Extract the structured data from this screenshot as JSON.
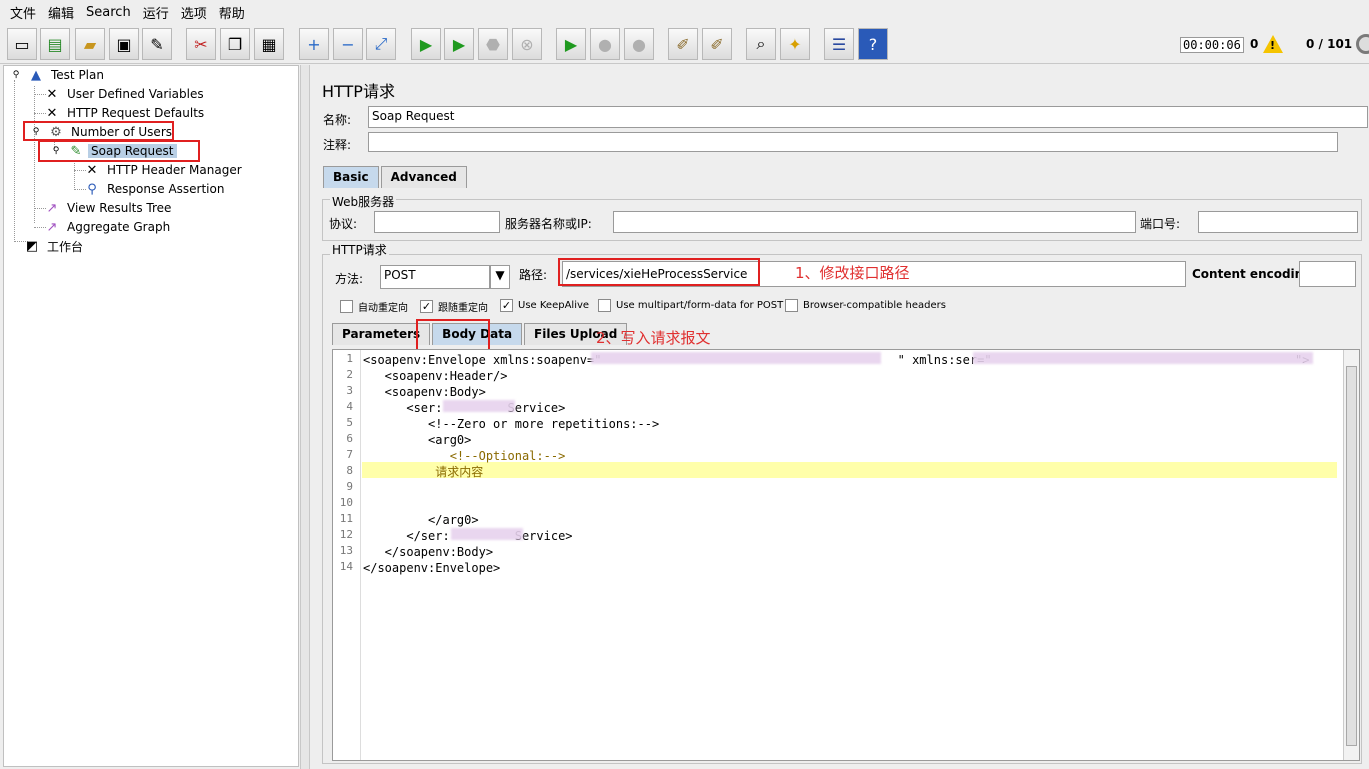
{
  "menu": [
    "文件",
    "编辑",
    "Search",
    "运行",
    "选项",
    "帮助"
  ],
  "status": {
    "timer": "00:00:06",
    "errors": "0",
    "threads": "0 / 101"
  },
  "tree": {
    "test_plan": "Test Plan",
    "user_defined_variables": "User Defined Variables",
    "http_request_defaults": "HTTP Request Defaults",
    "number_of_users": "Number of Users",
    "soap_request": "Soap Request",
    "http_header_manager": "HTTP Header Manager",
    "response_assertion": "Response Assertion",
    "view_results_tree": "View Results Tree",
    "aggregate_graph": "Aggregate Graph",
    "workbench": "工作台"
  },
  "panel": {
    "title": "HTTP请求",
    "name_label": "名称:",
    "name_value": "Soap Request",
    "comment_label": "注释:",
    "tabs": [
      "Basic",
      "Advanced"
    ],
    "web_server_title": "Web服务器",
    "protocol_label": "协议:",
    "server_label": "服务器名称或IP:",
    "port_label": "端口号:",
    "http_request_title": "HTTP请求",
    "method_label": "方法:",
    "method_value": "POST",
    "path_label": "路径:",
    "path_value": "/services/xieHeProcessService",
    "encoding_label": "Content encoding:",
    "checkboxes": [
      {
        "label": "自动重定向",
        "checked": false
      },
      {
        "label": "跟随重定向",
        "checked": true
      },
      {
        "label": "Use KeepAlive",
        "checked": true
      },
      {
        "label": "Use multipart/form-data for POST",
        "checked": false
      },
      {
        "label": "Browser-compatible headers",
        "checked": false
      }
    ],
    "body_tabs": [
      "Parameters",
      "Body Data",
      "Files Upload"
    ],
    "annotation_1": "1、修改接口路径",
    "annotation_2": "2、写入请求报文"
  },
  "code_lines": [
    {
      "n": "1",
      "text": "<soapenv:Envelope xmlns:soapenv=\"                                         \" xmlns:ser=\"                                          \">"
    },
    {
      "n": "2",
      "text": "   <soapenv:Header/>"
    },
    {
      "n": "3",
      "text": "   <soapenv:Body>"
    },
    {
      "n": "4",
      "text": "      <ser:         Service>"
    },
    {
      "n": "5",
      "text": "         <!--Zero or more repetitions:-->"
    },
    {
      "n": "6",
      "text": "         <arg0>"
    },
    {
      "n": "7",
      "text": "            <!--Optional:-->"
    },
    {
      "n": "8",
      "text": "          请求内容"
    },
    {
      "n": "9",
      "text": ""
    },
    {
      "n": "10",
      "text": ""
    },
    {
      "n": "11",
      "text": "         </arg0>"
    },
    {
      "n": "12",
      "text": "      </ser:         Service>"
    },
    {
      "n": "13",
      "text": "   </soapenv:Body>"
    },
    {
      "n": "14",
      "text": "</soapenv:Envelope>"
    }
  ]
}
